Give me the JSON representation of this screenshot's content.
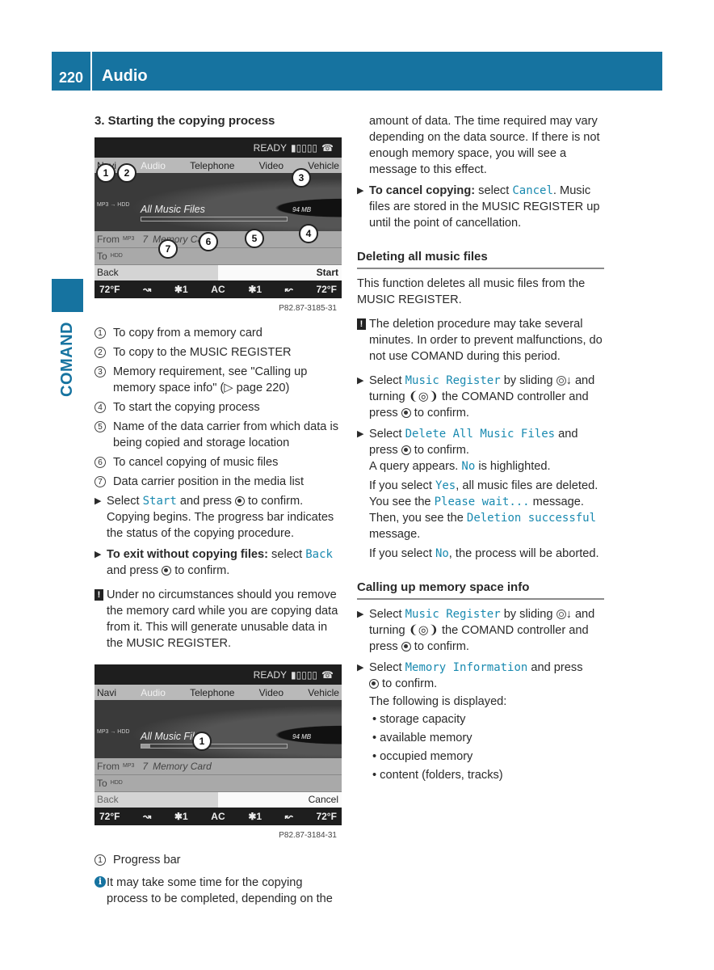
{
  "header": {
    "page_number": "220",
    "chapter": "Audio"
  },
  "side_tab": {
    "label": "COMAND"
  },
  "left": {
    "heading": "3. Starting the copying process",
    "screen1": {
      "status": {
        "ready": "READY",
        "signal": "▮▯▯▯▯",
        "phone": "☎"
      },
      "tabs": [
        "Navi",
        "Audio",
        "Telephone",
        "Video",
        "Vehicle"
      ],
      "active_tab": "Audio",
      "source_icons": "MP3 → HDD",
      "files_label": "All Music Files",
      "memory": "94 MB",
      "progress_pct": 0,
      "from_label": "From",
      "from_icon": "MP3",
      "from_pos": "7",
      "from_name": "Memory Card",
      "to_label": "To",
      "to_icon": "HDD",
      "back": "Back",
      "action": "Start",
      "climate": [
        "72°F",
        "↝",
        "✱1",
        "AC",
        "✱1",
        "↜",
        "72°F"
      ],
      "code": "P82.87-3185-31",
      "callouts": [
        "1",
        "2",
        "3",
        "4",
        "5",
        "6",
        "7"
      ]
    },
    "legend": [
      {
        "n": "1",
        "text": "To copy from a memory card"
      },
      {
        "n": "2",
        "text": "To copy to the MUSIC REGISTER"
      },
      {
        "n": "3",
        "text": "Memory requirement, see \"Calling up memory space info\" (▷ page 220)"
      },
      {
        "n": "4",
        "text": "To start the copying process"
      },
      {
        "n": "5",
        "text": "Name of the data carrier from which data is being copied and storage location"
      },
      {
        "n": "6",
        "text": "To cancel copying of music files"
      },
      {
        "n": "7",
        "text": "Data carrier position in the media list"
      }
    ],
    "step1": {
      "pre": "Select ",
      "code": "Start",
      "post": " and press",
      "post2": " to confirm. Copying begins. The progress bar indicates the status of the copying procedure."
    },
    "step2": {
      "bold": "To exit without copying files:",
      "pre": " select ",
      "code": "Back",
      "post": " and press",
      "post2": " to confirm."
    },
    "warning": "Under no circumstances should you remove the memory card while you are copying data from it. This will generate unusable data in the MUSIC REGISTER.",
    "screen2": {
      "status": {
        "ready": "READY",
        "signal": "▮▯▯▯▯",
        "phone": "☎"
      },
      "tabs": [
        "Navi",
        "Audio",
        "Telephone",
        "Video",
        "Vehicle"
      ],
      "active_tab": "Audio",
      "source_icons": "MP3 → HDD",
      "files_label": "All Music Files",
      "memory": "94 MB",
      "progress_pct": 6,
      "from_label": "From",
      "from_icon": "MP3",
      "from_pos": "7",
      "from_name": "Memory Card",
      "to_label": "To",
      "to_icon": "HDD",
      "back": "Back",
      "action": "Cancel",
      "climate": [
        "72°F",
        "↝",
        "✱1",
        "AC",
        "✱1",
        "↜",
        "72°F"
      ],
      "code": "P82.87-3184-31",
      "callouts": [
        "1"
      ]
    },
    "legend2": [
      {
        "n": "1",
        "text": "Progress bar"
      }
    ],
    "info": "It may take some time for the copying process to be completed, depending on the"
  },
  "right": {
    "continued": "amount of data. The time required may vary depending on the data source. If there is not enough memory space, you will see a message to this effect.",
    "cancel_step": {
      "bold": "To cancel copying:",
      "pre": " select ",
      "code": "Cancel",
      "post": ". Music files are stored in the MUSIC REGISTER up until the point of cancellation."
    },
    "delete_section": {
      "title": "Deleting all music files",
      "intro": "This function deletes all music files from the MUSIC REGISTER.",
      "warning": "The deletion procedure may take several minutes. In order to prevent malfunctions, do not use COMAND during this period.",
      "step1": {
        "pre": "Select ",
        "code": "Music Register",
        "mid": " by sliding ",
        "mid2": " and turning ",
        "mid3": " the COMAND controller and press",
        "post": " to confirm."
      },
      "step2": {
        "pre": "Select ",
        "code": "Delete All Music Files",
        "mid": " and press",
        "post": " to confirm.",
        "query_pre": "A query appears. ",
        "query_code": "No",
        "query_post": " is highlighted.",
        "yes_pre": "If you select ",
        "yes_code": "Yes",
        "yes_post": ", all music files are deleted. You see the ",
        "wait_code": "Please wait...",
        "wait_post": " message. Then, you see the ",
        "success_code": "Deletion successful",
        "success_post": " message.",
        "no_pre": "If you select ",
        "no_code": "No",
        "no_post": ", the process will be aborted."
      }
    },
    "memory_section": {
      "title": "Calling up memory space info",
      "step1": {
        "pre": "Select ",
        "code": "Music Register",
        "mid": " by sliding ",
        "mid2": " and turning ",
        "mid3": " the COMAND controller and press",
        "post": " to confirm."
      },
      "step2": {
        "pre": "Select ",
        "code": "Memory Information",
        "mid": " and press",
        "post": " to confirm.",
        "following": "The following is displayed:"
      },
      "bullets": [
        "storage capacity",
        "available memory",
        "occupied memory",
        "content (folders, tracks)"
      ]
    }
  }
}
